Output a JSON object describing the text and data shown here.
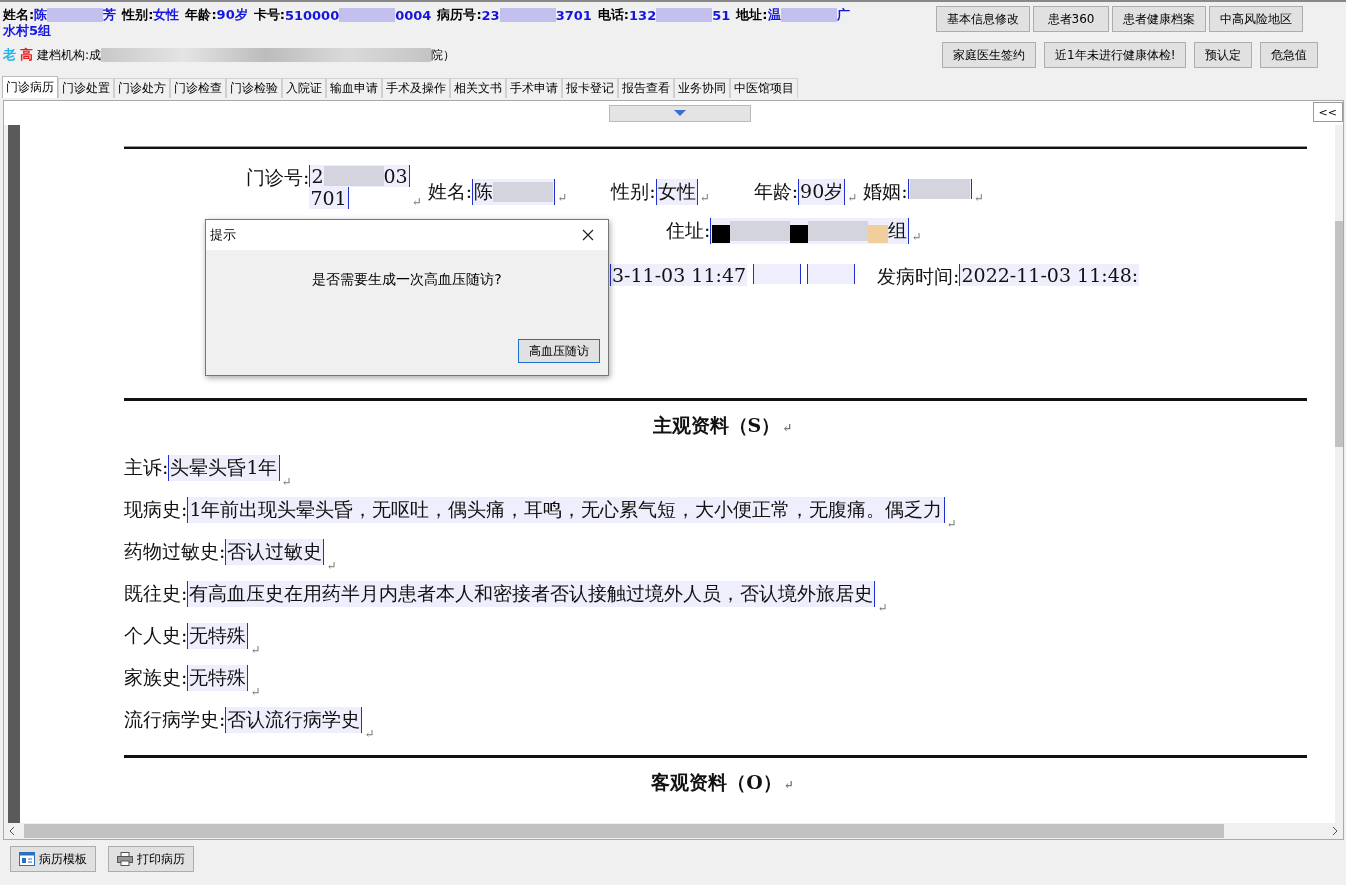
{
  "patient_bar": {
    "fields": [
      {
        "label": "姓名:",
        "segments": [
          {
            "kind": "text",
            "text": "陈"
          },
          {
            "kind": "blur"
          },
          {
            "kind": "text",
            "text": "芳"
          }
        ]
      },
      {
        "label": "性别:",
        "segments": [
          {
            "kind": "text",
            "text": "女性"
          }
        ]
      },
      {
        "label": "年龄:",
        "segments": [
          {
            "kind": "text",
            "text": "90岁"
          }
        ]
      },
      {
        "label": "卡号:",
        "segments": [
          {
            "kind": "text",
            "text": "510000"
          },
          {
            "kind": "blur"
          },
          {
            "kind": "text",
            "text": "0004"
          }
        ]
      },
      {
        "label": "病历号:",
        "segments": [
          {
            "kind": "text",
            "text": "23"
          },
          {
            "kind": "blur"
          },
          {
            "kind": "text",
            "text": "3701"
          }
        ]
      },
      {
        "label": "电话:",
        "segments": [
          {
            "kind": "text",
            "text": "132"
          },
          {
            "kind": "blur"
          },
          {
            "kind": "text",
            "text": "51"
          }
        ]
      },
      {
        "label": "地址:",
        "segments": [
          {
            "kind": "text",
            "text": "温"
          },
          {
            "kind": "blur"
          },
          {
            "kind": "text",
            "text": "广"
          }
        ]
      }
    ],
    "address_continued": "水村5组",
    "tags": [
      {
        "text": "老",
        "color": "#1fb5e8"
      },
      {
        "text": "高",
        "color": "#e81c1c"
      }
    ],
    "org_label": "建档机构:",
    "org_segments": [
      {
        "kind": "text",
        "text": "成"
      },
      {
        "kind": "blur"
      },
      {
        "kind": "text",
        "text": "院）"
      }
    ],
    "buttons_row1": [
      "基本信息修改",
      "患者360",
      "患者健康档案",
      "中高风险地区"
    ],
    "buttons_row2": [
      "家庭医生签约",
      "近1年未进行健康体检!",
      "预认定",
      "危急值"
    ]
  },
  "tabs": [
    {
      "label": "门诊病历",
      "selected": true
    },
    {
      "label": "门诊处置",
      "selected": false
    },
    {
      "label": "门诊处方",
      "selected": false
    },
    {
      "label": "门诊检查",
      "selected": false
    },
    {
      "label": "门诊检验",
      "selected": false
    },
    {
      "label": "入院证",
      "selected": false
    },
    {
      "label": "输血申请",
      "selected": false
    },
    {
      "label": "手术及操作",
      "selected": false
    },
    {
      "label": "相关文书",
      "selected": false
    },
    {
      "label": "手术申请",
      "selected": false
    },
    {
      "label": "报卡登记",
      "selected": false
    },
    {
      "label": "报告查看",
      "selected": false
    },
    {
      "label": "业务协同",
      "selected": false
    },
    {
      "label": "中医馆项目",
      "selected": false
    }
  ],
  "collapse_button": "<<",
  "document": {
    "rows": [
      {
        "items": [
          {
            "label": "门诊号:",
            "segments": [
              {
                "kind": "text",
                "text": "2"
              },
              {
                "kind": "blur"
              },
              {
                "kind": "text",
                "text": "03"
              }
            ],
            "continued": "701",
            "mark": "↵"
          },
          {
            "label": "姓名:",
            "segments": [
              {
                "kind": "text",
                "text": "陈"
              },
              {
                "kind": "blur"
              }
            ],
            "mark": "↵"
          },
          {
            "label": "性别:",
            "segments": [
              {
                "kind": "text",
                "text": "女性"
              }
            ],
            "mark": "↵"
          },
          {
            "label": "年龄:",
            "segments": [
              {
                "kind": "text",
                "text": "90岁"
              }
            ],
            "mark": "↵"
          },
          {
            "label": "婚姻:",
            "segments": [
              {
                "kind": "blur"
              }
            ],
            "mark": "↵"
          }
        ]
      },
      {
        "items": [
          {
            "label": "住址:",
            "segments": [
              {
                "kind": "black"
              },
              {
                "kind": "blur"
              },
              {
                "kind": "black"
              },
              {
                "kind": "blur"
              },
              {
                "kind": "tan"
              },
              {
                "kind": "text",
                "text": "组"
              }
            ],
            "mark": "↵"
          }
        ]
      },
      {
        "items": [
          {
            "segments": [
              {
                "kind": "text",
                "text": "3-11-03 11:47"
              }
            ],
            "open_end": true
          },
          {
            "segments": [
              {
                "kind": "gap"
              }
            ]
          },
          {
            "segments": [
              {
                "kind": "gap"
              }
            ]
          },
          {
            "label": "发病时间:",
            "segments": [
              {
                "kind": "text",
                "text": "2022-11-03 11:48:"
              }
            ],
            "open_end": true
          }
        ]
      }
    ],
    "sections": [
      {
        "heading": "主观资料（S）",
        "mark": "↵",
        "lines": [
          {
            "label": "主诉:",
            "value": "头晕头昏1年",
            "mark": "↵"
          },
          {
            "label": "现病史:",
            "value": "1年前出现头晕头昏，无呕吐，偶头痛，耳鸣，无心累气短，大小便正常，无腹痛。偶乏力",
            "mark": "↵"
          },
          {
            "label": "药物过敏史:",
            "value": "否认过敏史",
            "mark": "↵"
          },
          {
            "label": "既往史:",
            "value": "有高血压史在用药半月内患者本人和密接者否认接触过境外人员，否认境外旅居史",
            "mark": "↵"
          },
          {
            "label": "个人史:",
            "value": "无特殊",
            "mark": "↵"
          },
          {
            "label": "家族史:",
            "value": "无特殊",
            "mark": "↵"
          },
          {
            "label": "流行病学史:",
            "value": "否认流行病学史",
            "mark": "↵"
          }
        ]
      },
      {
        "heading": "客观资料（O）",
        "mark": "↵"
      }
    ]
  },
  "dialog": {
    "title": "提示",
    "message": "是否需要生成一次高血压随访?",
    "button": "高血压随访"
  },
  "footer_buttons": [
    "病历模板",
    "打印病历"
  ]
}
